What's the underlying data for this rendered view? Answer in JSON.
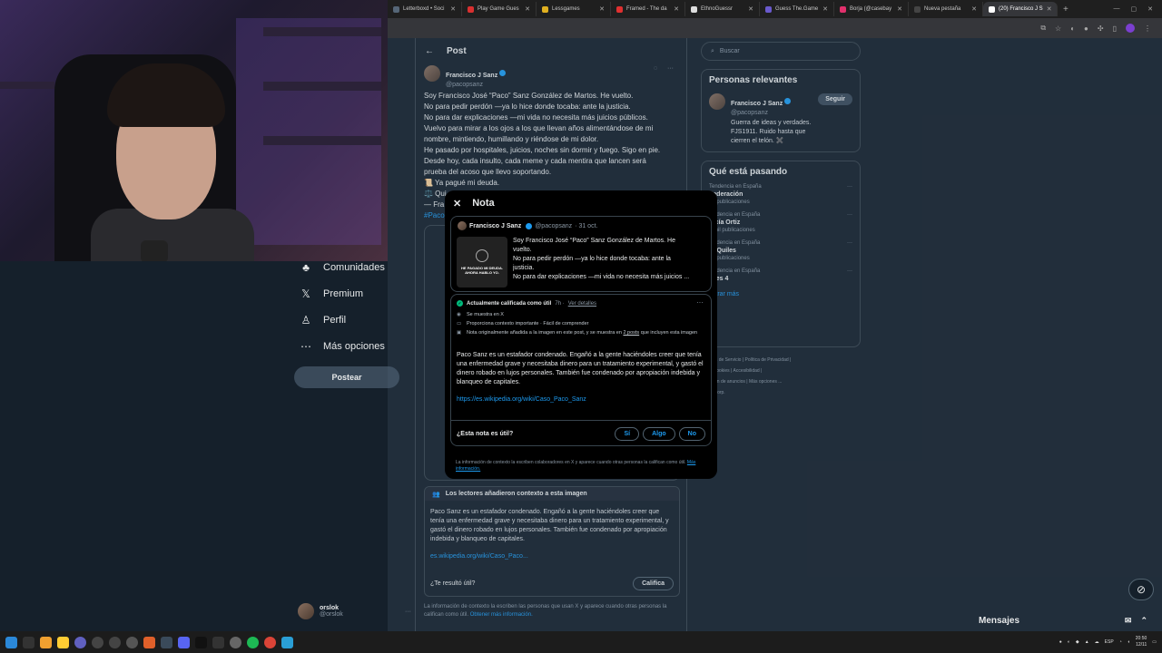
{
  "browser": {
    "tabs": [
      {
        "label": "Letterboxd • Soci",
        "color": "#556677",
        "active": false
      },
      {
        "label": "Play Game Gues",
        "color": "#d93030",
        "active": false
      },
      {
        "label": "Lessgames",
        "color": "#e0b020",
        "active": false
      },
      {
        "label": "Framed - The da",
        "color": "#e03030",
        "active": false
      },
      {
        "label": "EthnoGuessr",
        "color": "#dddddd",
        "active": false
      },
      {
        "label": "Guess The.Game",
        "color": "#6a5acd",
        "active": false
      },
      {
        "label": "Borja (@casebay",
        "color": "#e1306c",
        "active": false
      },
      {
        "label": "Nueva pestaña",
        "color": "#444444",
        "active": false
      },
      {
        "label": "(20) Francisco J S",
        "color": "#ffffff",
        "active": true
      }
    ],
    "new_tab": "+"
  },
  "sidenav": {
    "items": [
      {
        "icon": "communities-icon",
        "glyph": "♣",
        "label": "Comunidades"
      },
      {
        "icon": "x-premium-icon",
        "glyph": "𝕏",
        "label": "Premium"
      },
      {
        "icon": "profile-icon",
        "glyph": "♙",
        "label": "Perfil"
      },
      {
        "icon": "more-options-icon",
        "glyph": "⋯",
        "label": "Más opciones"
      }
    ],
    "post_button": "Postear",
    "account": {
      "name": "orslok",
      "handle": "@orslok"
    }
  },
  "timeline": {
    "header": "Post",
    "author": {
      "name": "Francisco J Sanz",
      "handle": "@pacopsanz"
    },
    "lines": [
      "Soy Francisco José “Paco” Sanz González de Martos. He vuelto.",
      "No para pedir perdón —ya lo hice donde tocaba: ante la justicia.",
      "No para dar explicaciones —mi vida no necesita más juicios públicos.",
      "Vuelvo para mirar a los ojos a los que llevan años alimentándose de mi",
      "nombre, mintiendo, humillando y riéndose de mi dolor.",
      "He pasado por hospitales, juicios, noches sin dormir y fuego. Sigo en pie.",
      "Desde hoy, cada insulto, cada meme y cada mentira que lancen será",
      "prueba del acoso que llevo soportando.",
      "📜 Ya pagué mi deuda.",
      "⚖️ Qui",
      "— Fra"
    ],
    "hashtag_fragment": "#Paco",
    "context": {
      "title": "Los lectores añadieron contexto a esta imagen",
      "body": "Paco Sanz es un estafador condenado. Engañó a la gente haciéndoles creer que tenía una enfermedad grave y necesitaba dinero para un tratamiento experimental, y gastó el dinero robado en lujos personales. También fue condenado por apropiación indebida y blanqueo de capitales.",
      "link": "es.wikipedia.org/wiki/Caso_Paco...",
      "question": "¿Te resultó útil?",
      "rate_button": "Califica"
    },
    "footnote": "La información de contexto la escriben las personas que usan X y aparece cuando otras personas la califican como útil.",
    "footnote_link": "Obtener más información."
  },
  "rightcol": {
    "search_placeholder": "Buscar",
    "relevant": {
      "title": "Personas relevantes",
      "name": "Francisco J Sanz",
      "handle": "@pacopsanz",
      "follow": "Seguir",
      "bio": "Guerra de ideas y verdades. FJS1911. Ruido hasta que cierren el telón. ✖️"
    },
    "trending": {
      "title": "Qué está pasando",
      "items": [
        {
          "context": "Tendencia en España",
          "name": "Federación",
          "count": "20 publicaciones"
        },
        {
          "context": "tendencia en España",
          "name": "arcía Ortiz",
          "count": "4 mil publicaciones"
        },
        {
          "context": "tendencia en España",
          "name": "to Quiles",
          "count": "68 publicaciones"
        },
        {
          "context": "tendencia en España",
          "name": "eves 4",
          "count": ""
        }
      ],
      "more": "ostrar más"
    },
    "footer": [
      "diciones de Servicio",
      "Política de Privacidad",
      "ica de cookies",
      "Accesibilidad",
      "ormación de anuncios",
      "Más opciones ...",
      "025 X Corp."
    ]
  },
  "modal": {
    "title": "Nota",
    "quoted": {
      "name": "Francisco J Sanz",
      "handle": "@pacopsanz",
      "date": "· 31 oct.",
      "thumb_text": "HE PAGADO MI DEUDA. AHORA HABLO YO.",
      "lines": [
        "Soy Francisco José “Paco” Sanz González de Martos. He",
        "vuelto.",
        "No para pedir perdón —ya lo hice donde tocaba: ante la",
        "justicia.",
        "No para dar explicaciones —mi vida no necesita más juicios ..."
      ]
    },
    "note": {
      "status": "Actualmente calificada como útil",
      "age": "7h ·",
      "details": "Ver detalles",
      "row1": "Se muestra en X",
      "row2": "Proporciona contexto importante · Fácil de comprender",
      "row3a": "Nota originalmente añadida a la imagen en este post, y se muestra en",
      "row3link": "2 posts",
      "row3b": "que incluyen esta imagen",
      "text": "Paco Sanz es un estafador condenado. Engañó a la gente haciéndoles creer que tenía una enfermedad grave y necesitaba dinero para un tratamiento experimental, y gastó el dinero robado en lujos personales. También fue condenado por apropiación indebida y blanqueo de capitales.",
      "link": "https://es.wikipedia.org/wiki/Caso_Paco_Sanz",
      "question": "¿Esta nota es útil?",
      "votes": [
        "Sí",
        "Algo",
        "No"
      ]
    },
    "footer": "La información de contexto la escriben colaboradores en X y aparece cuando otras personas la califican como útil.",
    "footer_link": "Más información."
  },
  "messages": {
    "label": "Mensajes"
  },
  "taskbar": {
    "lang": "ESP",
    "time": "20:50",
    "date": "12/11"
  }
}
